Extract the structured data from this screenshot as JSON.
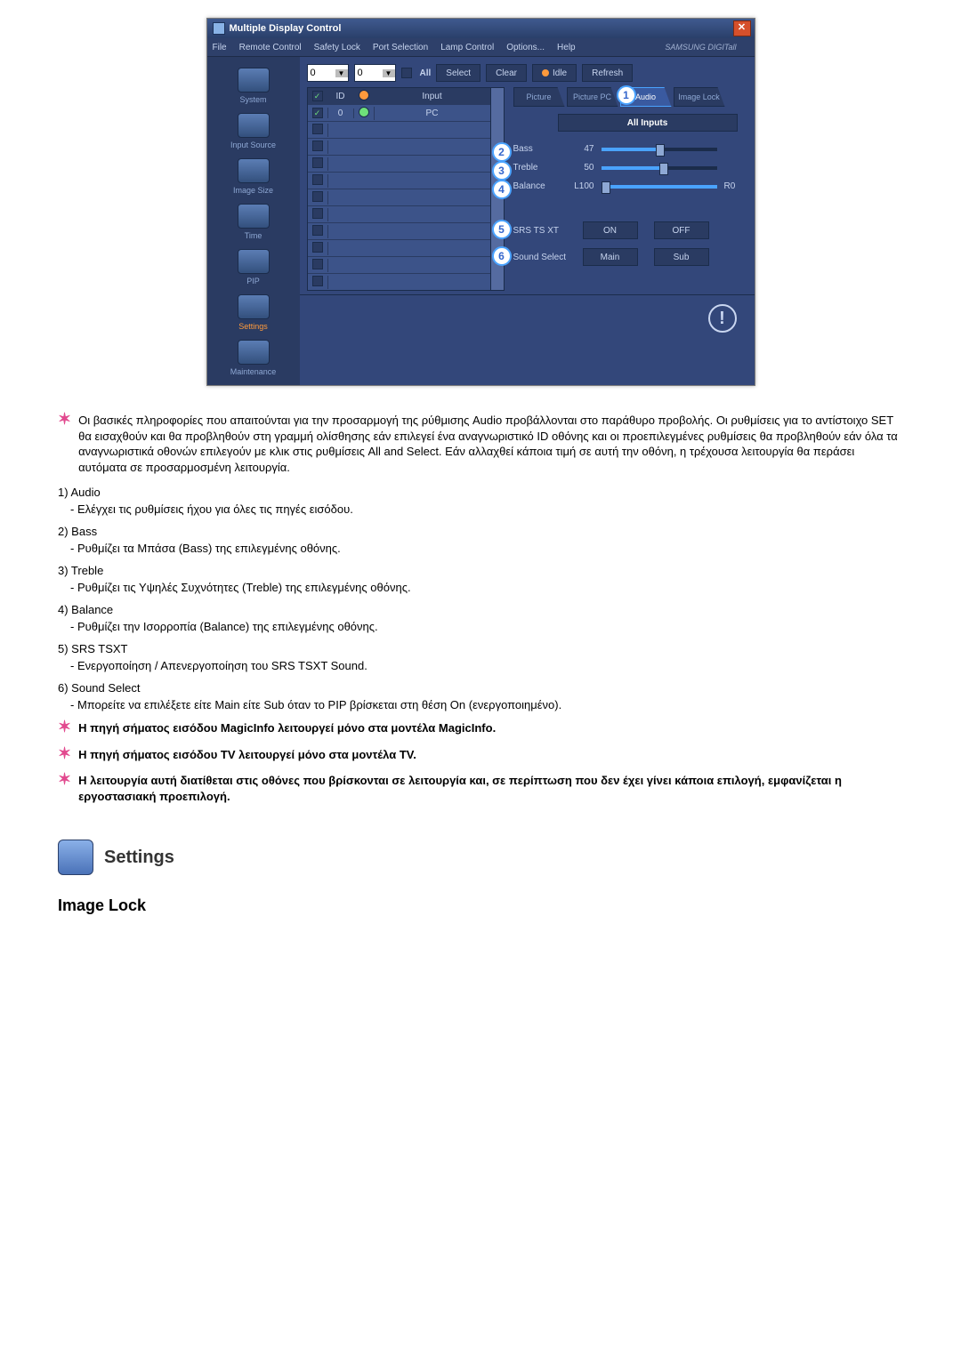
{
  "window": {
    "title": "Multiple Display Control"
  },
  "menu": [
    "File",
    "Remote Control",
    "Safety Lock",
    "Port Selection",
    "Lamp Control",
    "Options...",
    "Help"
  ],
  "brand": "SAMSUNG DIGITall",
  "sidebar": [
    {
      "label": "System"
    },
    {
      "label": "Input Source"
    },
    {
      "label": "Image Size"
    },
    {
      "label": "Time"
    },
    {
      "label": "PIP"
    },
    {
      "label": "Settings",
      "active": true
    },
    {
      "label": "Maintenance"
    }
  ],
  "toolbar": {
    "drop1": "0",
    "drop2": "0",
    "all": "All",
    "select": "Select",
    "clear": "Clear",
    "idle": "Idle",
    "refresh": "Refresh"
  },
  "grid": {
    "headers": {
      "id": "ID",
      "input": "Input"
    },
    "rows": [
      {
        "checked": true,
        "id": "0",
        "status": "green",
        "input": "PC"
      },
      {
        "checked": false,
        "id": "",
        "status": "",
        "input": ""
      },
      {
        "checked": false,
        "id": "",
        "status": "",
        "input": ""
      },
      {
        "checked": false,
        "id": "",
        "status": "",
        "input": ""
      },
      {
        "checked": false,
        "id": "",
        "status": "",
        "input": ""
      },
      {
        "checked": false,
        "id": "",
        "status": "",
        "input": ""
      },
      {
        "checked": false,
        "id": "",
        "status": "",
        "input": ""
      },
      {
        "checked": false,
        "id": "",
        "status": "",
        "input": ""
      },
      {
        "checked": false,
        "id": "",
        "status": "",
        "input": ""
      },
      {
        "checked": false,
        "id": "",
        "status": "",
        "input": ""
      },
      {
        "checked": false,
        "id": "",
        "status": "",
        "input": ""
      }
    ]
  },
  "tabs": {
    "picture": "Picture",
    "picturepc": "Picture PC",
    "audio": "Audio",
    "imagelock": "Image Lock"
  },
  "allinputs": "All Inputs",
  "sliders": {
    "bass": {
      "label": "Bass",
      "value": "47"
    },
    "treble": {
      "label": "Treble",
      "value": "50"
    },
    "balance": {
      "label": "Balance",
      "left": "L100",
      "right": "R0"
    }
  },
  "srs": {
    "label": "SRS TS XT",
    "on": "ON",
    "off": "OFF"
  },
  "sound": {
    "label": "Sound Select",
    "main": "Main",
    "sub": "Sub"
  },
  "callouts": {
    "c1": "1",
    "c2": "2",
    "c3": "3",
    "c4": "4",
    "c5": "5",
    "c6": "6"
  },
  "desc": {
    "intro": "Οι βασικές πληροφορίες που απαιτούνται για την προσαρμογή της ρύθμισης Audio προβάλλονται στο παράθυρο προβολής. Οι ρυθμίσεις για το αντίστοιχο SET θα εισαχθούν και θα προβληθούν στη γραμμή ολίσθησης εάν επιλεγεί ένα αναγνωριστικό ID οθόνης και οι προεπιλεγμένες ρυθμίσεις θα προβληθούν εάν όλα τα αναγνωριστικά οθονών επιλεγούν με κλικ στις ρυθμίσεις All and Select. Εάν αλλαχθεί κάποια τιμή σε αυτή την οθόνη, η τρέχουσα λειτουργία θα περάσει αυτόματα σε προσαρμοσμένη λειτουργία.",
    "items": [
      {
        "h": "1)  Audio",
        "b": "- Ελέγχει τις ρυθμίσεις ήχου για όλες τις πηγές εισόδου."
      },
      {
        "h": "2)  Bass",
        "b": "- Ρυθμίζει τα Μπάσα (Bass) της επιλεγμένης οθόνης."
      },
      {
        "h": "3)  Treble",
        "b": "- Ρυθμίζει τις Υψηλές Συχνότητες (Treble) της επιλεγμένης οθόνης."
      },
      {
        "h": "4)  Balance",
        "b": "- Ρυθμίζει την Ισορροπία (Balance) της επιλεγμένης οθόνης."
      },
      {
        "h": "5)  SRS TSXT",
        "b": "- Ενεργοποίηση / Απενεργοποίηση του SRS TSXT Sound."
      },
      {
        "h": "6)  Sound Select",
        "b": "- Μπορείτε να επιλέξετε είτε Main είτε Sub όταν το PIP βρίσκεται στη θέση On (ενεργοποιημένο)."
      }
    ],
    "notes": [
      "Η πηγή σήματος εισόδου MagicInfo λειτουργεί μόνο στα μοντέλα MagicInfo.",
      "Η πηγή σήματος εισόδου TV λειτουργεί μόνο στα μοντέλα TV.",
      "Η λειτουργία αυτή διατίθεται στις οθόνες που βρίσκονται σε λειτουργία και, σε περίπτωση που δεν έχει γίνει κάποια επιλογή, εμφανίζεται η εργοστασιακή προεπιλογή."
    ]
  },
  "section": {
    "title": "Settings"
  },
  "subhead": "Image Lock"
}
